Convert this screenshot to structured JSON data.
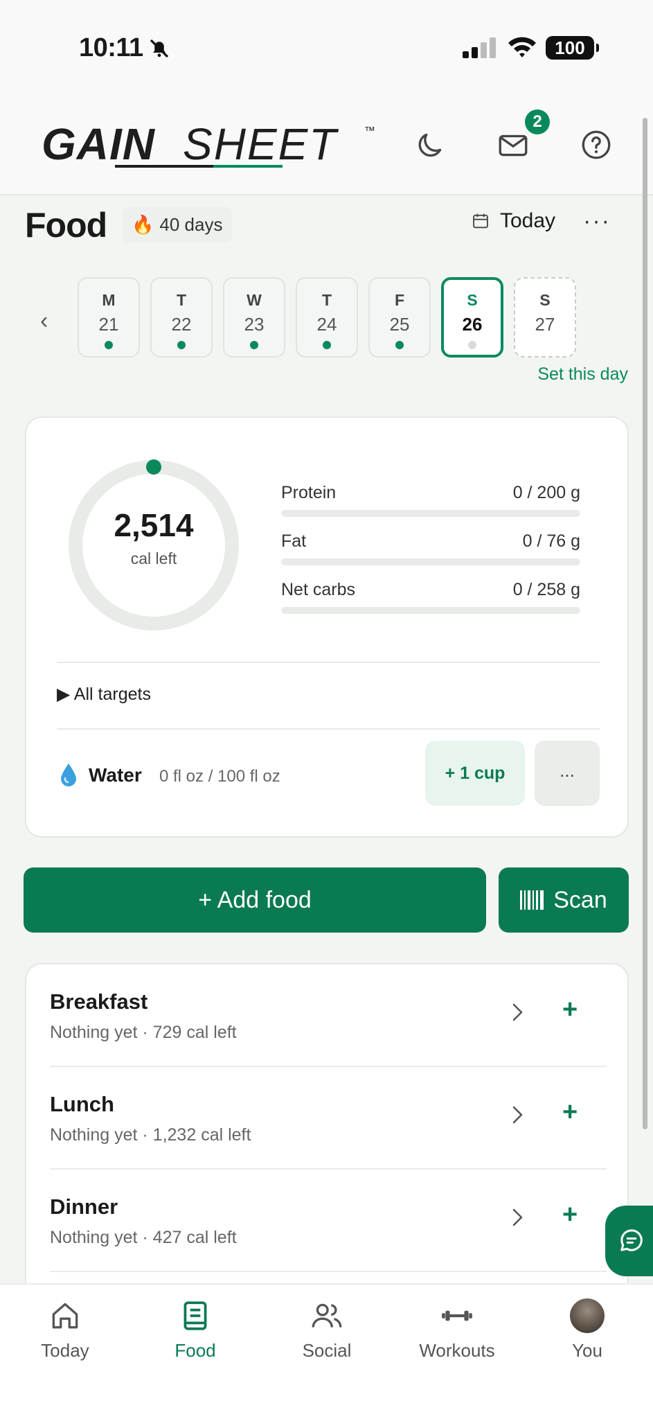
{
  "status_bar": {
    "time": "10:11",
    "battery": "100"
  },
  "header": {
    "logo_text_left": "GAIN",
    "logo_text_right": "SHEET",
    "trademark": "™",
    "inbox_count": "2",
    "icons": [
      "moon-icon",
      "mail-icon",
      "help-icon"
    ]
  },
  "page": {
    "title": "Food",
    "streak_emoji": "🔥",
    "streak": "40 days",
    "today_label": "Today",
    "more": "···"
  },
  "week": {
    "prev": "‹",
    "days": [
      {
        "letter": "M",
        "num": "21",
        "state": "logged"
      },
      {
        "letter": "T",
        "num": "22",
        "state": "logged"
      },
      {
        "letter": "W",
        "num": "23",
        "state": "logged"
      },
      {
        "letter": "T",
        "num": "24",
        "state": "logged"
      },
      {
        "letter": "F",
        "num": "25",
        "state": "logged"
      },
      {
        "letter": "S",
        "num": "26",
        "state": "selected"
      },
      {
        "letter": "S",
        "num": "27",
        "state": "future"
      }
    ],
    "set_day": "Set this day"
  },
  "summary": {
    "calories_left": "2,514",
    "calories_label": "cal left",
    "calorie_progress": 0,
    "macros": [
      {
        "name": "Protein",
        "value": "0 / 200 g",
        "progress": 0
      },
      {
        "name": "Fat",
        "value": "0 / 76 g",
        "progress": 0
      },
      {
        "name": "Net carbs",
        "value": "0 / 258 g",
        "progress": 0
      }
    ],
    "all_targets": "▶ All targets",
    "water": {
      "label": "Water",
      "value": "0 fl oz / 100 fl oz",
      "add_label": "+ 1 cup",
      "more_label": "..."
    }
  },
  "actions": {
    "add_food": "+ Add food",
    "scan": "Scan"
  },
  "meals": [
    {
      "name": "Breakfast",
      "subtitle": "Nothing yet · 729 cal left"
    },
    {
      "name": "Lunch",
      "subtitle": "Nothing yet · 1,232 cal left"
    },
    {
      "name": "Dinner",
      "subtitle": "Nothing yet · 427 cal left"
    }
  ],
  "nav": {
    "items": [
      {
        "label": "Today",
        "icon": "home-icon"
      },
      {
        "label": "Food",
        "icon": "journal-icon",
        "active": true
      },
      {
        "label": "Social",
        "icon": "people-icon"
      },
      {
        "label": "Workouts",
        "icon": "dumbbell-icon"
      },
      {
        "label": "You",
        "icon": "avatar"
      }
    ]
  },
  "colors": {
    "accent": "#0a7a52",
    "accent_light": "#e7f5ee",
    "background": "#f3f5f3"
  }
}
